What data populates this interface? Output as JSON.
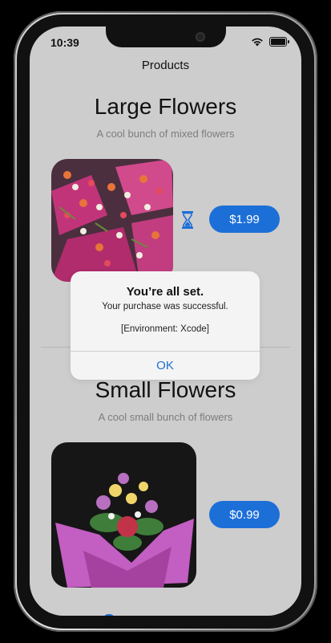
{
  "status_bar": {
    "time": "10:39"
  },
  "nav": {
    "title": "Products"
  },
  "products": [
    {
      "title": "Large Flowers",
      "subtitle": "A cool bunch of mixed flowers",
      "price": "$1.99",
      "loading": true
    },
    {
      "title": "Small Flowers",
      "subtitle": "A cool small bunch of flowers",
      "price": "$0.99",
      "loading": false
    }
  ],
  "alert": {
    "title": "You’re all set.",
    "message": "Your purchase was successful.",
    "environment": "[Environment: Xcode]",
    "ok_label": "OK"
  },
  "colors": {
    "accent": "#1d6fd8",
    "background": "#cdcdcd",
    "alert_bg": "#f4f4f4"
  },
  "icons": {
    "loading": "hourglass-icon",
    "wifi": "wifi-icon",
    "battery": "battery-icon"
  }
}
